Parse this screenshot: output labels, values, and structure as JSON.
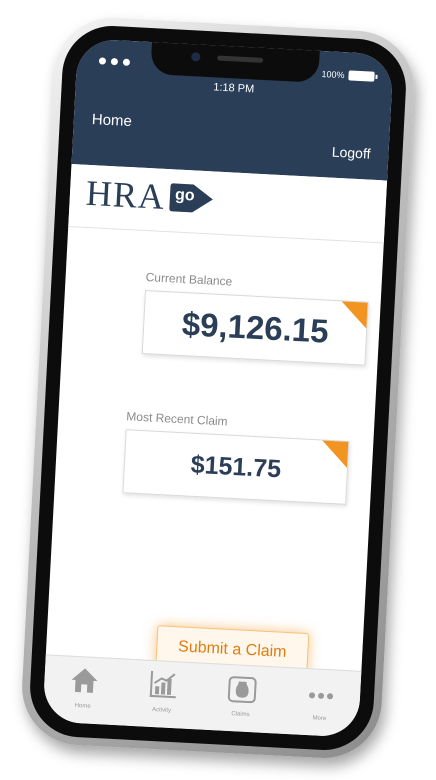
{
  "status_bar": {
    "time": "1:18 PM",
    "battery": "100%"
  },
  "header": {
    "home_label": "Home",
    "logoff_label": "Logoff"
  },
  "brand": {
    "logo_text": "HRA",
    "logo_badge": "go"
  },
  "balance": {
    "label": "Current Balance",
    "value": "$9,126.15"
  },
  "recent_claim": {
    "label": "Most Recent Claim",
    "value": "$151.75"
  },
  "submit_button": {
    "label": "Submit a Claim"
  },
  "tabs": [
    {
      "label": "Home",
      "icon": "home-icon"
    },
    {
      "label": "Activity",
      "icon": "chart-icon"
    },
    {
      "label": "Claims",
      "icon": "money-bag-icon"
    },
    {
      "label": "More",
      "icon": "more-icon"
    }
  ],
  "colors": {
    "header_bg": "#2b3e57",
    "accent": "#f29422",
    "value_text": "#2b3e57"
  }
}
